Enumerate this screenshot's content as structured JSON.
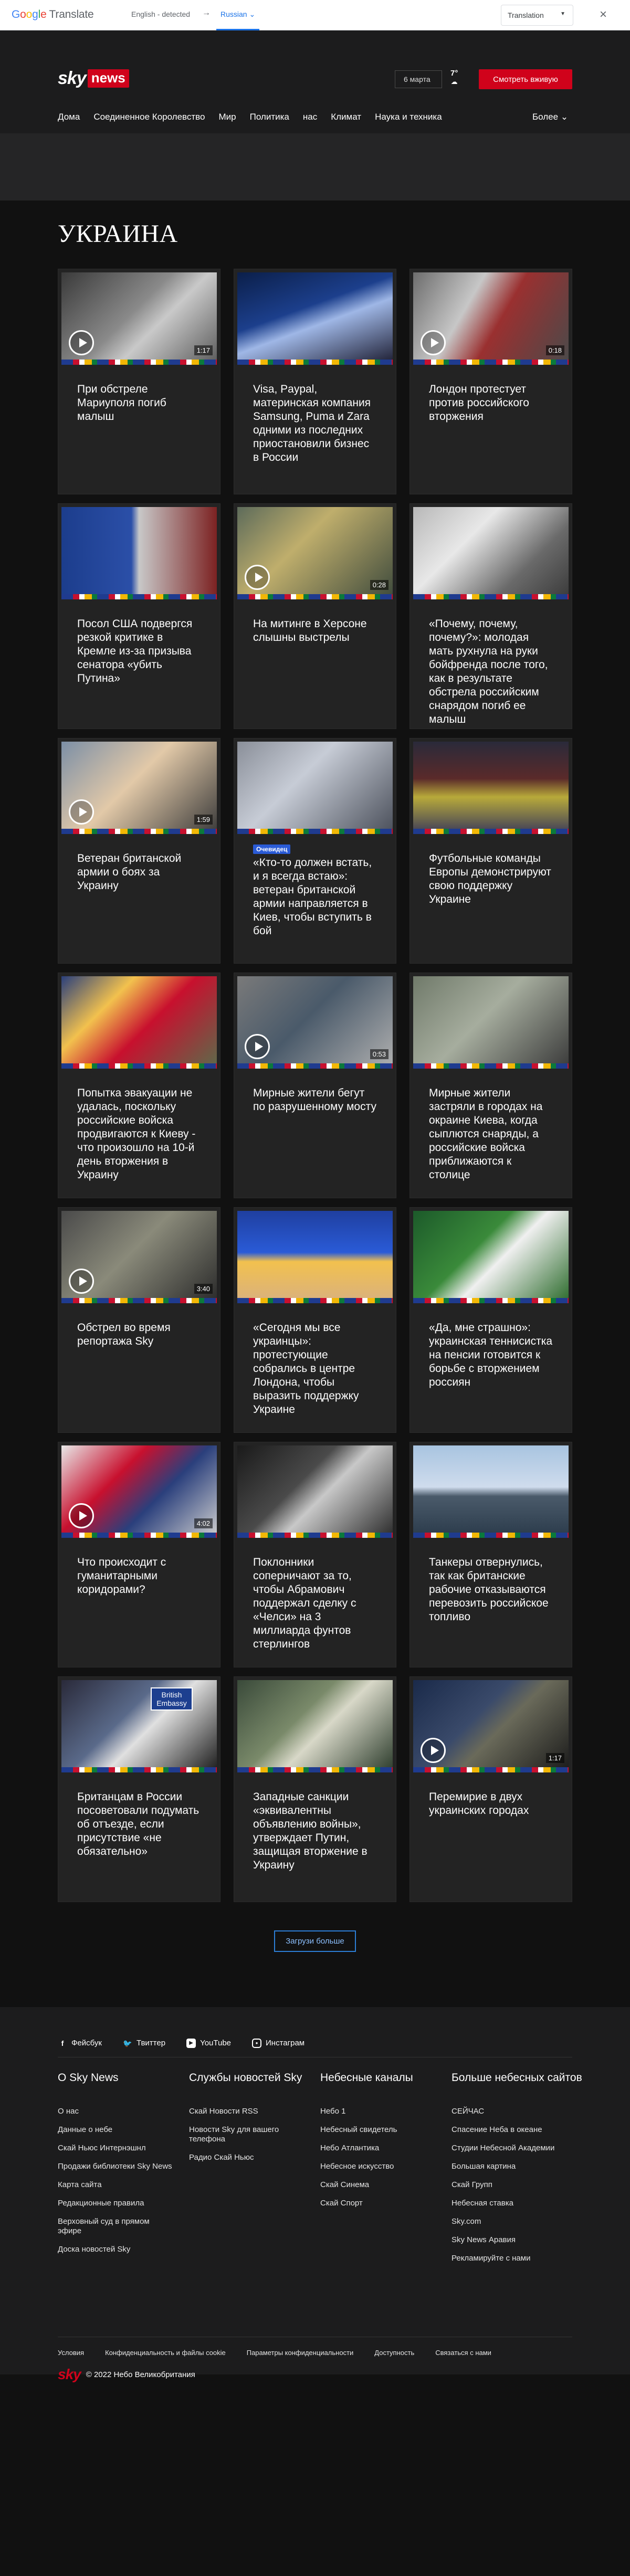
{
  "translate_bar": {
    "source_language": "English - detected",
    "target_language": "Russian",
    "mode_select": "Translation"
  },
  "header": {
    "logo_sky": "sky",
    "logo_news": "news",
    "date": "6 марта",
    "temperature": "7°",
    "watch_live": "Смотреть вживую",
    "nav": [
      "Дома",
      "Соединенное Королевство",
      "Мир",
      "Политика",
      "нас",
      "Климат",
      "Наука и техника"
    ],
    "nav_more": "Более"
  },
  "section": {
    "title": "УКРАИНА",
    "cards": [
      {
        "title": "При обстреле Мариуполя погиб малыш",
        "duration": "1:17",
        "video": true,
        "thumb": "baby"
      },
      {
        "title": "Visa, Paypal, материнская компания Samsung, Puma и Zara одними из последних приостановили бизнес в России",
        "duration": "",
        "video": false,
        "thumb": "paypal"
      },
      {
        "title": "Лондон протестует против российского вторжения",
        "duration": "0:18",
        "video": true,
        "thumb": "protest"
      },
      {
        "title": "Посол США подвергся резкой критике в Кремле из-за призыва сенатора «убить Путина»",
        "duration": "",
        "video": false,
        "thumb": "putin-senator"
      },
      {
        "title": "На митинге в Херсоне слышны выстрелы",
        "duration": "0:28",
        "video": true,
        "thumb": "kherson"
      },
      {
        "title": "«Почему, почему, почему?»: молодая мать рухнула на руки бойфренда после того, как в результате обстрела российским снарядом погиб ее малыш",
        "duration": "",
        "video": false,
        "thumb": "mother"
      },
      {
        "title": "Ветеран британской армии о боях за Украину",
        "duration": "1:59",
        "video": true,
        "thumb": "veteran"
      },
      {
        "title": "«Кто-то должен встать, и я всегда встаю»: ветеран британской армии направляется в Киев, чтобы вступить в бой",
        "duration": "",
        "video": false,
        "badge": "Очевидец",
        "thumb": "street"
      },
      {
        "title": "Футбольные команды Европы демонстрируют свою поддержку Украине",
        "duration": "",
        "video": false,
        "thumb": "stadium"
      },
      {
        "title": "Попытка эвакуации не удалась, поскольку российские войска продвигаются к Киеву - что произошло на 10-й день вторжения в Украину",
        "duration": "",
        "video": false,
        "thumb": "map"
      },
      {
        "title": "Мирные жители бегут по разрушенному мосту",
        "duration": "0:53",
        "video": true,
        "thumb": "bridge"
      },
      {
        "title": "Мирные жители застряли в городах на окраине Киева, когда сыплются снаряды, а российские войска приближаются к столице",
        "duration": "",
        "video": false,
        "thumb": "reporter"
      },
      {
        "title": "Обстрел во время репортажа Sky",
        "duration": "3:40",
        "video": true,
        "thumb": "helmet"
      },
      {
        "title": "«Сегодня мы все украинцы»: протестующие собрались в центре Лондона, чтобы выразить поддержку Украине",
        "duration": "",
        "video": false,
        "thumb": "flowers"
      },
      {
        "title": "«Да, мне страшно»: украинская теннисистка на пенсии готовится к борьбе с вторжением россиян",
        "duration": "",
        "video": false,
        "thumb": "tennis"
      },
      {
        "title": "Что происходит с гуманитарными коридорами?",
        "duration": "4:02",
        "video": true,
        "thumb": "map-studio"
      },
      {
        "title": "Поклонники соперничают за то, чтобы Абрамович поддержал сделку с «Челси» на 3 миллиарда фунтов стерлингов",
        "duration": "",
        "video": false,
        "thumb": "trophy"
      },
      {
        "title": "Танкеры отвернулись, так как британские рабочие отказываются перевозить российское топливо",
        "duration": "",
        "video": false,
        "thumb": "tanker"
      },
      {
        "title": "Британцам в России посоветовали подумать об отъезде, если присутствие «не обязательно»",
        "duration": "",
        "video": false,
        "thumb": "embassy",
        "sign_text": "British Embassy"
      },
      {
        "title": "Западные санкции «эквивалентны объявлению войны», утверждает Путин, защищая вторжение в Украину",
        "duration": "",
        "video": false,
        "thumb": "putin-desk"
      },
      {
        "title": "Перемирие в двух украинских городах",
        "duration": "1:17",
        "video": true,
        "thumb": "zelensky"
      }
    ],
    "load_more": "Загрузи больше"
  },
  "footer": {
    "social": [
      {
        "label": "Фейсбук",
        "icon": "facebook-icon"
      },
      {
        "label": "Твиттер",
        "icon": "twitter-icon"
      },
      {
        "label": "YouTube",
        "icon": "youtube-icon"
      },
      {
        "label": "Инстаграм",
        "icon": "instagram-icon"
      }
    ],
    "columns": [
      {
        "title": "О Sky News",
        "links": [
          "О нас",
          "Данные о небе",
          "Скай Ньюс Интернэшнл",
          "Продажи библиотеки Sky News",
          "Карта сайта",
          "Редакционные правила",
          "Верховный суд в прямом эфире",
          "Доска новостей Sky"
        ]
      },
      {
        "title": "Службы новостей Sky",
        "links": [
          "Скай Новости RSS",
          "Новости Sky для вашего телефона",
          "Радио Скай Ньюс"
        ]
      },
      {
        "title": "Небесные каналы",
        "links": [
          "Небо 1",
          "Небесный свидетель",
          "Небо Атлантика",
          "Небесное искусство",
          "Скай Синема",
          "Скай Спорт"
        ]
      },
      {
        "title": "Больше небесных сайтов",
        "links": [
          "СЕЙЧАС",
          "Спасение Неба в океане",
          "Студии Небесной Академии",
          "Большая картина",
          "Скай Групп",
          "Небесная ставка",
          "Sky.com",
          "Sky News Аравия",
          "Рекламируйте с нами"
        ]
      }
    ],
    "legal": [
      "Условия",
      "Конфиденциальность и файлы cookie",
      "Параметры конфиденциальности",
      "Доступность",
      "Связаться с нами"
    ],
    "copyright": "© 2022 Небо Великобритания",
    "mini_logo": "sky"
  },
  "colors": {
    "page_bg": "#111111",
    "card_bg": "#232323",
    "brand_red": "#d0021b",
    "link_blue": "#2c7ed6"
  }
}
